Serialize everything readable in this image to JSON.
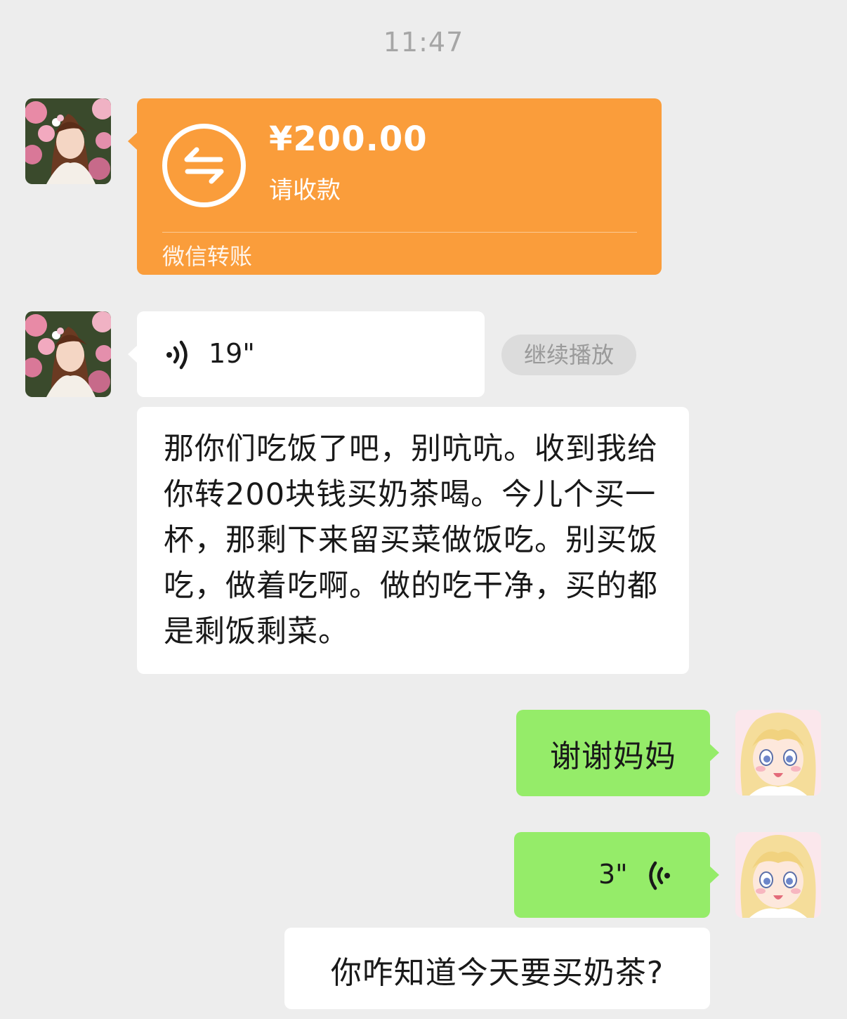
{
  "status_time": "11:47",
  "transfer": {
    "amount": "¥200.00",
    "status": "请收款",
    "footer": "微信转账"
  },
  "voice_incoming": {
    "duration": "19\"",
    "continue_label": "继续播放"
  },
  "message_incoming_text": "那你们吃饭了吧，别吭吭。收到我给你转200块钱买奶茶喝。今儿个买一杯，那剩下来留买菜做饭吃。别买饭吃，做着吃啊。做的吃干净，买的都是剩饭剩菜。",
  "message_thanks": "谢谢妈妈",
  "voice_outgoing": {
    "duration": "3\""
  },
  "message_outgoing_text": "你咋知道今天要买奶茶?",
  "colors": {
    "background": "#ededed",
    "transfer_orange": "#fa9d3b",
    "outgoing_green": "#95ec69",
    "incoming_white": "#ffffff"
  },
  "icons": [
    "transfer-arrows-icon",
    "voice-wave-icon",
    "avatar-mother",
    "avatar-user"
  ]
}
